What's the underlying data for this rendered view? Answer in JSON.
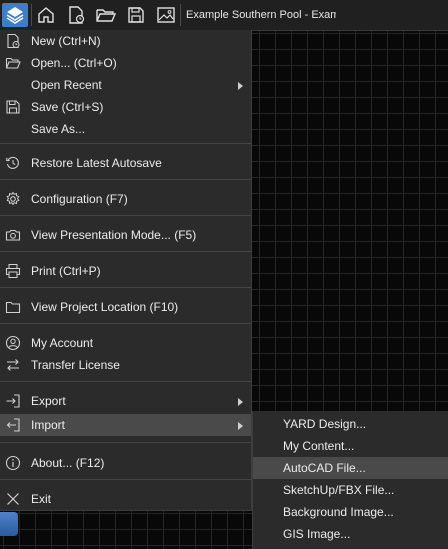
{
  "window": {
    "title": "Example Southern Pool - Examp"
  },
  "toolbar": {
    "buttons": [
      "app-logo-icon",
      "home-icon",
      "new-file-icon",
      "open-folder-icon",
      "save-icon",
      "image-icon"
    ]
  },
  "menu": {
    "items": {
      "new": "New (Ctrl+N)",
      "open": "Open... (Ctrl+O)",
      "open_recent": "Open Recent",
      "save": "Save (Ctrl+S)",
      "save_as": "Save As...",
      "restore": "Restore Latest Autosave",
      "configuration": "Configuration (F7)",
      "presentation": "View Presentation Mode... (F5)",
      "print": "Print (Ctrl+P)",
      "project_location": "View Project Location (F10)",
      "my_account": "My Account",
      "transfer_license": "Transfer License",
      "export": "Export",
      "import": "Import",
      "about": "About... (F12)",
      "exit": "Exit"
    }
  },
  "import_submenu": {
    "items": {
      "yard": "YARD Design...",
      "my_content": "My Content...",
      "autocad": "AutoCAD File...",
      "sketchup": "SketchUp/FBX File...",
      "background": "Background Image...",
      "gis": "GIS Image..."
    },
    "highlighted": "AutoCAD File..."
  },
  "colors": {
    "accent": "#3c7ec8",
    "menu_bg": "#2b2b2b",
    "highlight": "#4a4a4a",
    "canvas": "#080808"
  }
}
